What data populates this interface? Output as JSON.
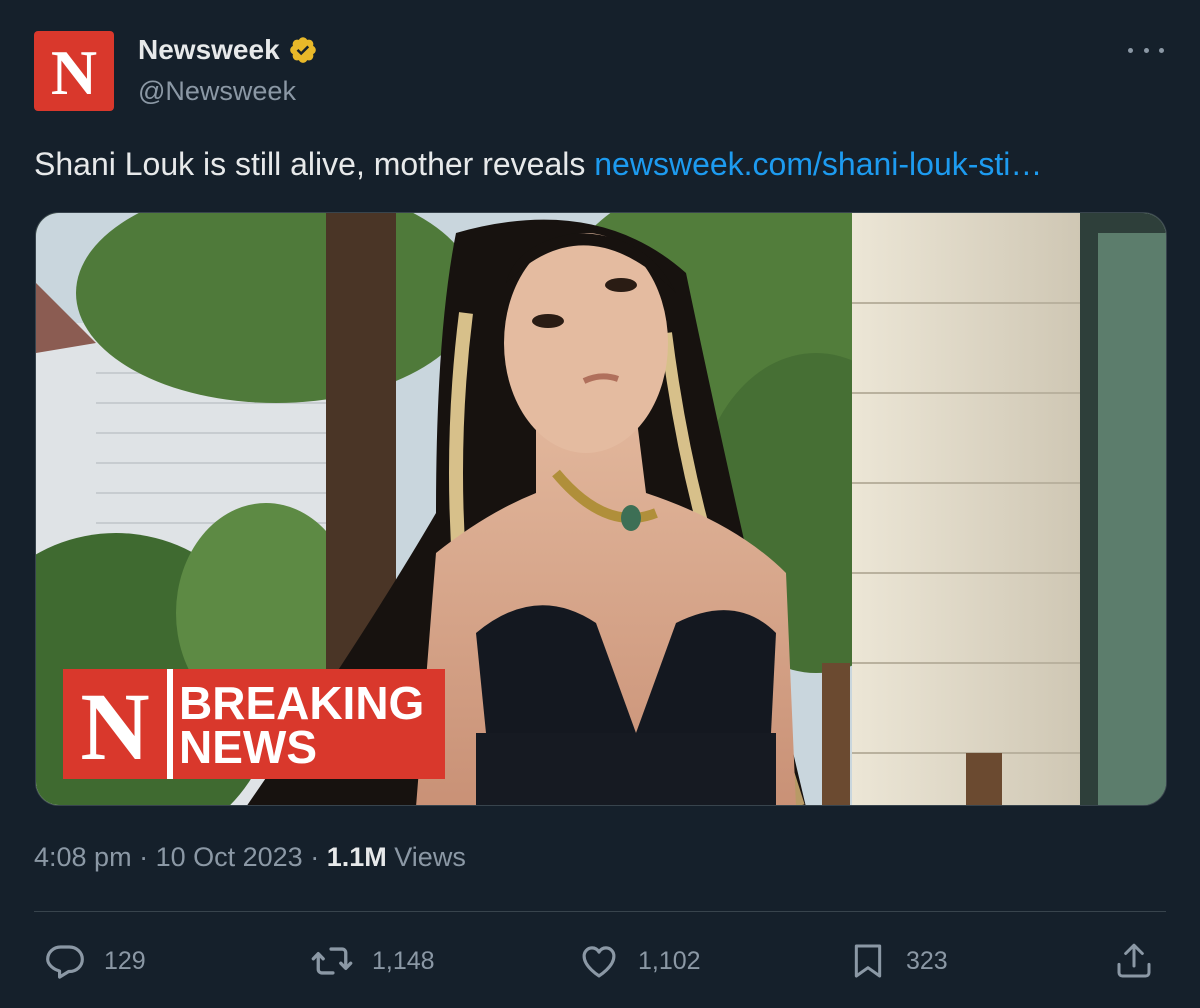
{
  "author": {
    "avatar_letter": "N",
    "display_name": "Newsweek",
    "handle": "@Newsweek",
    "verified": true,
    "brand_color": "#d9382c"
  },
  "tweet": {
    "text": "Shani Louk is still alive, mother reveals ",
    "link": "newsweek.com/shani-louk-sti…",
    "link_color": "#1d9bf0"
  },
  "media": {
    "badge_logo": "N",
    "badge_line1": "BREAKING",
    "badge_line2": "NEWS"
  },
  "meta": {
    "time": "4:08 pm",
    "sep1": "·",
    "date": "10 Oct 2023",
    "sep2": "·",
    "views_count": "1.1M",
    "views_label": "Views"
  },
  "actions": {
    "reply_count": "129",
    "retweet_count": "1,148",
    "like_count": "1,102",
    "bookmark_count": "323"
  },
  "icons": {
    "more": "more-icon",
    "verified": "verified-badge-icon",
    "reply": "reply-icon",
    "retweet": "retweet-icon",
    "like": "heart-icon",
    "bookmark": "bookmark-icon",
    "share": "share-icon"
  },
  "colors": {
    "background": "#15202b",
    "secondary_text": "#8b98a5",
    "verified_gold": "#e8b829"
  }
}
